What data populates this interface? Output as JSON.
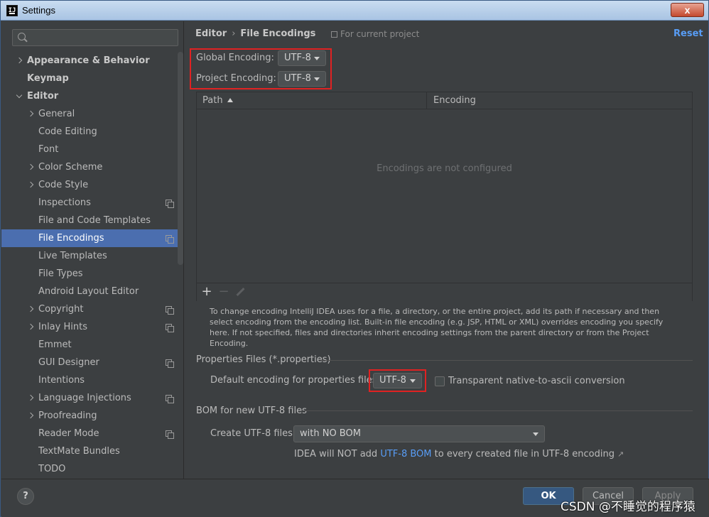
{
  "window": {
    "title": "Settings",
    "close_label": "x"
  },
  "sidebar": {
    "search": {
      "placeholder": ""
    },
    "items": [
      {
        "label": "Appearance & Behavior",
        "level": 0,
        "chevron": "right",
        "bold": true,
        "copy": false,
        "selected": false
      },
      {
        "label": "Keymap",
        "level": 0,
        "chevron": "none",
        "bold": true,
        "copy": false,
        "selected": false
      },
      {
        "label": "Editor",
        "level": 0,
        "chevron": "down",
        "bold": true,
        "copy": false,
        "selected": false
      },
      {
        "label": "General",
        "level": 1,
        "chevron": "right",
        "bold": false,
        "copy": false,
        "selected": false
      },
      {
        "label": "Code Editing",
        "level": 1,
        "chevron": "none",
        "bold": false,
        "copy": false,
        "selected": false
      },
      {
        "label": "Font",
        "level": 1,
        "chevron": "none",
        "bold": false,
        "copy": false,
        "selected": false
      },
      {
        "label": "Color Scheme",
        "level": 1,
        "chevron": "right",
        "bold": false,
        "copy": false,
        "selected": false
      },
      {
        "label": "Code Style",
        "level": 1,
        "chevron": "right",
        "bold": false,
        "copy": false,
        "selected": false
      },
      {
        "label": "Inspections",
        "level": 1,
        "chevron": "none",
        "bold": false,
        "copy": true,
        "selected": false
      },
      {
        "label": "File and Code Templates",
        "level": 1,
        "chevron": "none",
        "bold": false,
        "copy": false,
        "selected": false
      },
      {
        "label": "File Encodings",
        "level": 1,
        "chevron": "none",
        "bold": false,
        "copy": true,
        "selected": true
      },
      {
        "label": "Live Templates",
        "level": 1,
        "chevron": "none",
        "bold": false,
        "copy": false,
        "selected": false
      },
      {
        "label": "File Types",
        "level": 1,
        "chevron": "none",
        "bold": false,
        "copy": false,
        "selected": false
      },
      {
        "label": "Android Layout Editor",
        "level": 1,
        "chevron": "none",
        "bold": false,
        "copy": false,
        "selected": false
      },
      {
        "label": "Copyright",
        "level": 1,
        "chevron": "right",
        "bold": false,
        "copy": true,
        "selected": false
      },
      {
        "label": "Inlay Hints",
        "level": 1,
        "chevron": "right",
        "bold": false,
        "copy": true,
        "selected": false
      },
      {
        "label": "Emmet",
        "level": 1,
        "chevron": "none",
        "bold": false,
        "copy": false,
        "selected": false
      },
      {
        "label": "GUI Designer",
        "level": 1,
        "chevron": "none",
        "bold": false,
        "copy": true,
        "selected": false
      },
      {
        "label": "Intentions",
        "level": 1,
        "chevron": "none",
        "bold": false,
        "copy": false,
        "selected": false
      },
      {
        "label": "Language Injections",
        "level": 1,
        "chevron": "right",
        "bold": false,
        "copy": true,
        "selected": false
      },
      {
        "label": "Proofreading",
        "level": 1,
        "chevron": "right",
        "bold": false,
        "copy": false,
        "selected": false
      },
      {
        "label": "Reader Mode",
        "level": 1,
        "chevron": "none",
        "bold": false,
        "copy": true,
        "selected": false
      },
      {
        "label": "TextMate Bundles",
        "level": 1,
        "chevron": "none",
        "bold": false,
        "copy": false,
        "selected": false
      },
      {
        "label": "TODO",
        "level": 1,
        "chevron": "none",
        "bold": false,
        "copy": false,
        "selected": false
      }
    ]
  },
  "header": {
    "breadcrumb_parent": "Editor",
    "breadcrumb_sep": "›",
    "breadcrumb_current": "File Encodings",
    "project_note": "For current project",
    "reset": "Reset"
  },
  "encodings": {
    "global_label": "Global Encoding:",
    "global_value": "UTF-8",
    "project_label": "Project Encoding:",
    "project_value": "UTF-8"
  },
  "table": {
    "col_path": "Path",
    "col_encoding": "Encoding",
    "empty_text": "Encodings are not configured",
    "add": "+",
    "remove": "−"
  },
  "help_text": "To change encoding IntelliJ IDEA uses for a file, a directory, or the entire project, add its path if necessary and then select encoding from the encoding list. Built-in file encoding (e.g. JSP, HTML or XML) overrides encoding you specify here. If not specified, files and directories inherit encoding settings from the parent directory or from the Project Encoding.",
  "properties": {
    "section_title": "Properties Files (*.properties)",
    "default_label": "Default encoding for properties files:",
    "default_value": "UTF-8",
    "transparent_label": "Transparent native-to-ascii conversion",
    "transparent_checked": false
  },
  "bom": {
    "section_title": "BOM for new UTF-8 files",
    "create_label": "Create UTF-8 files:",
    "create_value": "with NO BOM",
    "info_prefix": "IDEA will NOT add ",
    "info_link": "UTF-8 BOM",
    "info_suffix": " to every created file in UTF-8 encoding",
    "info_arrow": "↗"
  },
  "footer": {
    "help": "?",
    "ok": "OK",
    "cancel": "Cancel",
    "apply": "Apply"
  },
  "watermark": "CSDN @不睡觉的程序猿",
  "colors": {
    "accent": "#4b6eaf",
    "link": "#589df6",
    "highlight_box": "#e02222",
    "background": "#3c3f41"
  }
}
